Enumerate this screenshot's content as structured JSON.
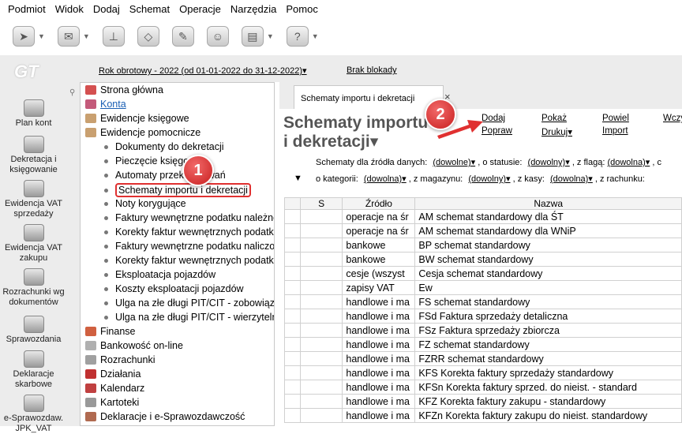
{
  "menu": [
    "Podmiot",
    "Widok",
    "Dodaj",
    "Schemat",
    "Operacje",
    "Narzędzia",
    "Pomoc"
  ],
  "toolbar_icons": [
    "navigation-icon",
    "document-icon",
    "stamp-icon",
    "eraser-icon",
    "brush-icon",
    "user-icon",
    "printer-icon",
    "help-icon"
  ],
  "logo": "GT",
  "left_items": [
    "Plan kont",
    "Dekretacja i księgowanie",
    "Ewidencja VAT sprzedaży",
    "Ewidencja VAT zakupu",
    "Rozrachunki wg dokumentów",
    "Sprawozdania",
    "Deklaracje skarbowe",
    "e-Sprawozdaw. JPK_VAT"
  ],
  "top_strip": {
    "fiscal_year": "Rok obrotowy - 2022  (od 01-01-2022 do 31-12-2022)▾",
    "lock": "Brak blokady"
  },
  "tree": {
    "items": [
      "Strona główna",
      "Konta",
      "Ewidencje księgowe",
      "Ewidencje pomocnicze"
    ],
    "sub_items": [
      "Dokumenty do dekretacji",
      "Pieczęcie księgowe",
      "Automaty przeksięgowań",
      "Schematy importu i dekretacji",
      "Noty korygujące",
      "Faktury wewnętrzne podatku należne",
      "Korekty faktur wewnętrznych podatku",
      "Faktury wewnętrzne podatku naliczon",
      "Korekty faktur wewnętrznych podatku",
      "Eksploatacja pojazdów",
      "Koszty eksploatacji pojazdów",
      "Ulga na złe długi PIT/CIT - zobowiąza",
      "Ulga na złe długi PIT/CIT - wierzytelno"
    ],
    "bottom_items": [
      "Finanse",
      "Bankowość on-line",
      "Rozrachunki",
      "Działania",
      "Kalendarz",
      "Kartoteki",
      "Deklaracje i e-Sprawozdawczość"
    ]
  },
  "tab": {
    "label": "Schematy importu i dekretacji",
    "close": "×"
  },
  "page_title_1": "Schematy importu",
  "page_title_2": "i dekretacji▾",
  "actions": {
    "dodaj": "Dodaj",
    "popraw": "Popraw",
    "pokaz": "Pokaż",
    "drukuj": "Drukuj▾",
    "powiel": "Powiel",
    "import": "Import",
    "wczy": "Wczy"
  },
  "filters": {
    "row1": {
      "label": "Schematy dla źródła danych:",
      "val1": "(dowolne)▾",
      "l2": ", o statusie:",
      "val2": "(dowolny)▾",
      "l3": ", z flagą:",
      "val3": "(dowolna)▾",
      "l4": ", c"
    },
    "row2": {
      "label": "o kategorii:",
      "val1": "(dowolna)▾",
      "l2": ", z magazynu:",
      "val2": "(dowolny)▾",
      "l3": ", z kasy:",
      "val3": "(dowolna)▾",
      "l4": ", z rachunku:"
    }
  },
  "badges": [
    "1",
    "2"
  ],
  "table": {
    "headers": [
      "",
      "S",
      "Źródło",
      "Nazwa"
    ],
    "rows": [
      [
        "operacje na śr",
        "AM schemat standardowy dla ŚT"
      ],
      [
        "operacje na śr",
        "AM schemat standardowy dla WNiP"
      ],
      [
        "bankowe",
        "BP schemat standardowy"
      ],
      [
        "bankowe",
        "BW schemat standardowy"
      ],
      [
        "cesje (wszyst",
        "Cesja schemat standardowy"
      ],
      [
        "zapisy VAT",
        "Ew"
      ],
      [
        "handlowe i ma",
        "FS schemat standardowy"
      ],
      [
        "handlowe i ma",
        "FSd Faktura sprzedaży detaliczna"
      ],
      [
        "handlowe i ma",
        "FSz Faktura sprzedaży zbiorcza"
      ],
      [
        "handlowe i ma",
        "FZ schemat standardowy"
      ],
      [
        "handlowe i ma",
        "FZRR schemat standardowy"
      ],
      [
        "handlowe i ma",
        "KFS Korekta faktury sprzedaży standardowy"
      ],
      [
        "handlowe i ma",
        "KFSn Korekta faktury sprzed. do nieist. - standard"
      ],
      [
        "handlowe i ma",
        "KFZ Korekta faktury zakupu - standardowy"
      ],
      [
        "handlowe i ma",
        "KFZn Korekta faktury zakupu do nieist. standardowy"
      ]
    ]
  }
}
